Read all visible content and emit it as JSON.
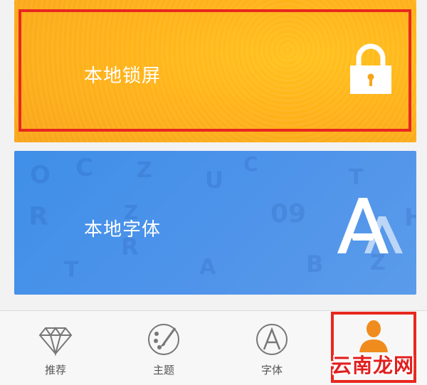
{
  "cards": {
    "lock": {
      "label": "本地锁屏",
      "icon": "padlock-icon",
      "color": "#ffb31a"
    },
    "font": {
      "label": "本地字体",
      "icon": "font-aa-icon",
      "color": "#4a90e8"
    }
  },
  "tabs": [
    {
      "label": "推荐",
      "icon": "diamond-icon"
    },
    {
      "label": "主题",
      "icon": "palette-icon"
    },
    {
      "label": "字体",
      "icon": "letter-a-icon"
    },
    {
      "label": "",
      "icon": "person-icon",
      "active_color": "#f08c1e"
    }
  ],
  "highlight_color": "#e8281f",
  "watermark": "云南龙网"
}
